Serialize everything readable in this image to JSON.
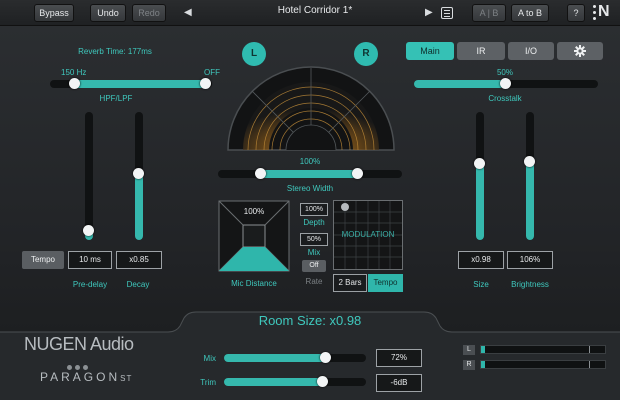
{
  "topbar": {
    "bypass": "Bypass",
    "undo": "Undo",
    "redo": "Redo",
    "prev_glyph": "◀",
    "preset": "Hotel Corridor 1*",
    "next_glyph": "▶",
    "ab_a": "A",
    "ab_b": "B",
    "a_to_b": "A to B",
    "help": "?",
    "logo_glyph": "N"
  },
  "left": {
    "reverb_time": "Reverb Time: 177ms",
    "hpf_value": "150 Hz",
    "lpf_value": "OFF",
    "hpf_lpf_label": "HPF/LPF",
    "predelay_level": 0.08,
    "decay_level": 0.52,
    "tempo": "Tempo",
    "predelay_value": "10 ms",
    "decay_value": "x0.85",
    "predelay_label": "Pre-delay",
    "decay_label": "Decay"
  },
  "center": {
    "l_label": "L",
    "r_label": "R",
    "width_value": "100%",
    "width_label": "Stereo Width",
    "mic_value": "100%",
    "mic_label": "Mic Distance",
    "depth_value": "100%",
    "depth_label": "Depth",
    "mix_value": "50%",
    "mix_label": "Mix",
    "off_label": "Off",
    "rate_label": "Rate",
    "bars_value": "2 Bars",
    "tempo_label": "Tempo",
    "modulation_label": "MODULATION",
    "room_size": "Room Size: x0.98"
  },
  "right": {
    "tabs": [
      "Main",
      "IR",
      "I/O"
    ],
    "settings_icon": "gear-icon",
    "crosstalk_value": "50%",
    "crosstalk_label": "Crosstalk",
    "size_level": 0.6,
    "brightness_level": 0.62,
    "size_value": "x0.98",
    "brightness_value": "106%",
    "size_label": "Size",
    "brightness_label": "Brightness"
  },
  "bottom": {
    "brand": "NUGEN Audio",
    "product": "PARAGON",
    "product_suffix": "ST",
    "mix_label": "Mix",
    "mix_value": "72%",
    "mix_level": 0.72,
    "trim_label": "Trim",
    "trim_value": "-6dB",
    "trim_level": 0.7,
    "meter_l": "L",
    "meter_r": "R"
  },
  "colors": {
    "accent": "#35b8ad",
    "background": "#1b1d1f"
  }
}
